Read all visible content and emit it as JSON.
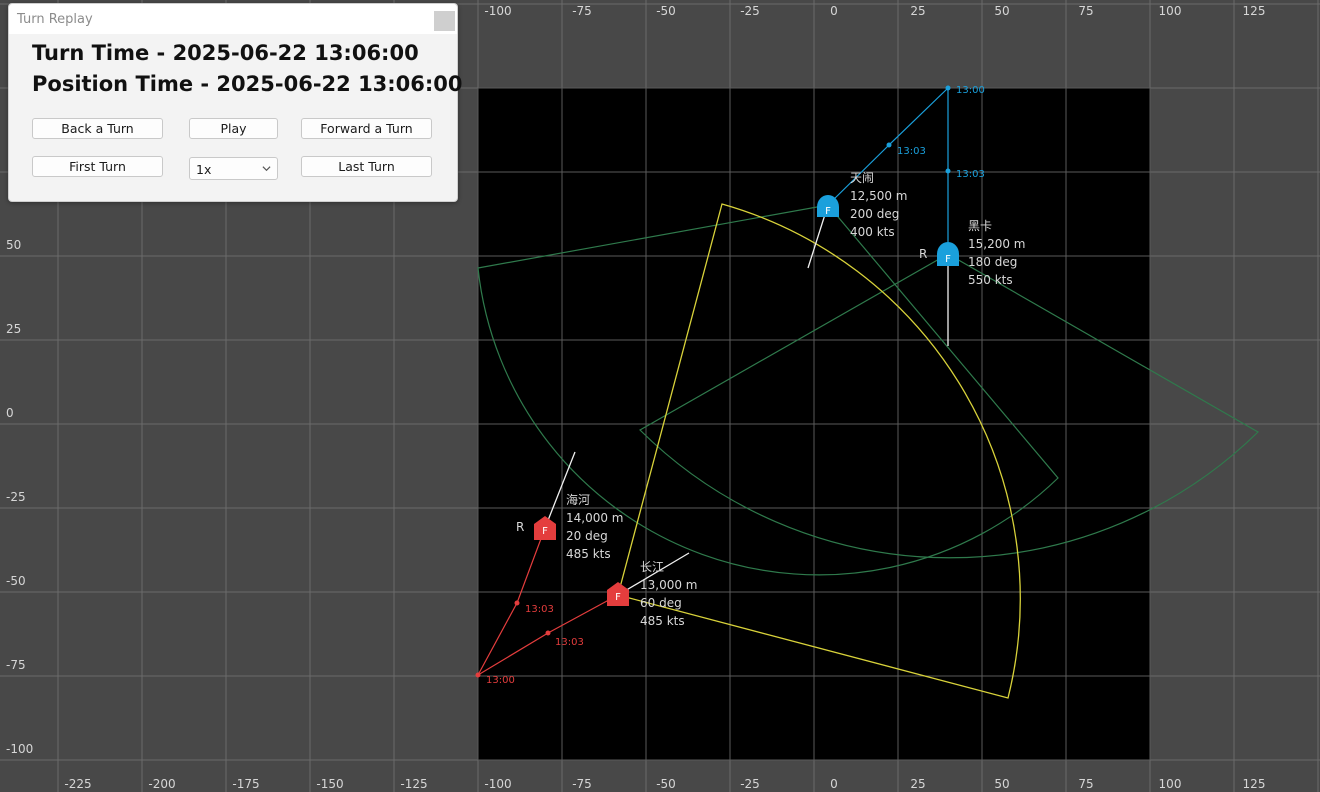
{
  "window": {
    "title": "Turn Replay",
    "turn_time": "Turn Time - 2025-06-22 13:06:00",
    "position_time": "Position Time - 2025-06-22 13:06:00"
  },
  "controls": {
    "back_label": "Back a Turn",
    "play_label": "Play",
    "forward_label": "Forward a Turn",
    "first_label": "First Turn",
    "speed_value": "1x",
    "last_label": "Last Turn"
  },
  "map": {
    "axis_top": [
      "-100",
      "-75",
      "-50",
      "-25",
      "0",
      "25",
      "50",
      "75",
      "100",
      "125"
    ],
    "axis_bottom": [
      "-225",
      "-200",
      "-175",
      "-150",
      "-125",
      "-100",
      "-75",
      "-50",
      "-25",
      "0",
      "25",
      "50",
      "75",
      "100",
      "125"
    ],
    "axis_left": [
      "50",
      "25",
      "0",
      "-25",
      "-50",
      "-75",
      "-100"
    ],
    "units": [
      {
        "name": "天闹",
        "altitude": "12,500 m",
        "heading": "200 deg",
        "speed": "400 kts",
        "marker": "F",
        "side": "blue",
        "flag": ""
      },
      {
        "name": "黑卡",
        "altitude": "15,200 m",
        "heading": "180 deg",
        "speed": "550 kts",
        "marker": "F",
        "side": "blue",
        "flag": "R"
      },
      {
        "name": "海河",
        "altitude": "14,000 m",
        "heading": "20 deg",
        "speed": "485 kts",
        "marker": "F",
        "side": "red",
        "flag": "R"
      },
      {
        "name": "长江",
        "altitude": "13,000 m",
        "heading": "60 deg",
        "speed": "485 kts",
        "marker": "F",
        "side": "red",
        "flag": ""
      }
    ],
    "blue_track_labels": [
      "13:00",
      "13:03",
      "13:03"
    ],
    "red_track_labels": [
      "13:03",
      "13:03",
      "13:00"
    ],
    "colors": {
      "blue": "#1aa0dc",
      "red": "#e43d3d",
      "sensor_yellow": "#d8d23a",
      "sensor_green": "#2f7a4c"
    }
  }
}
